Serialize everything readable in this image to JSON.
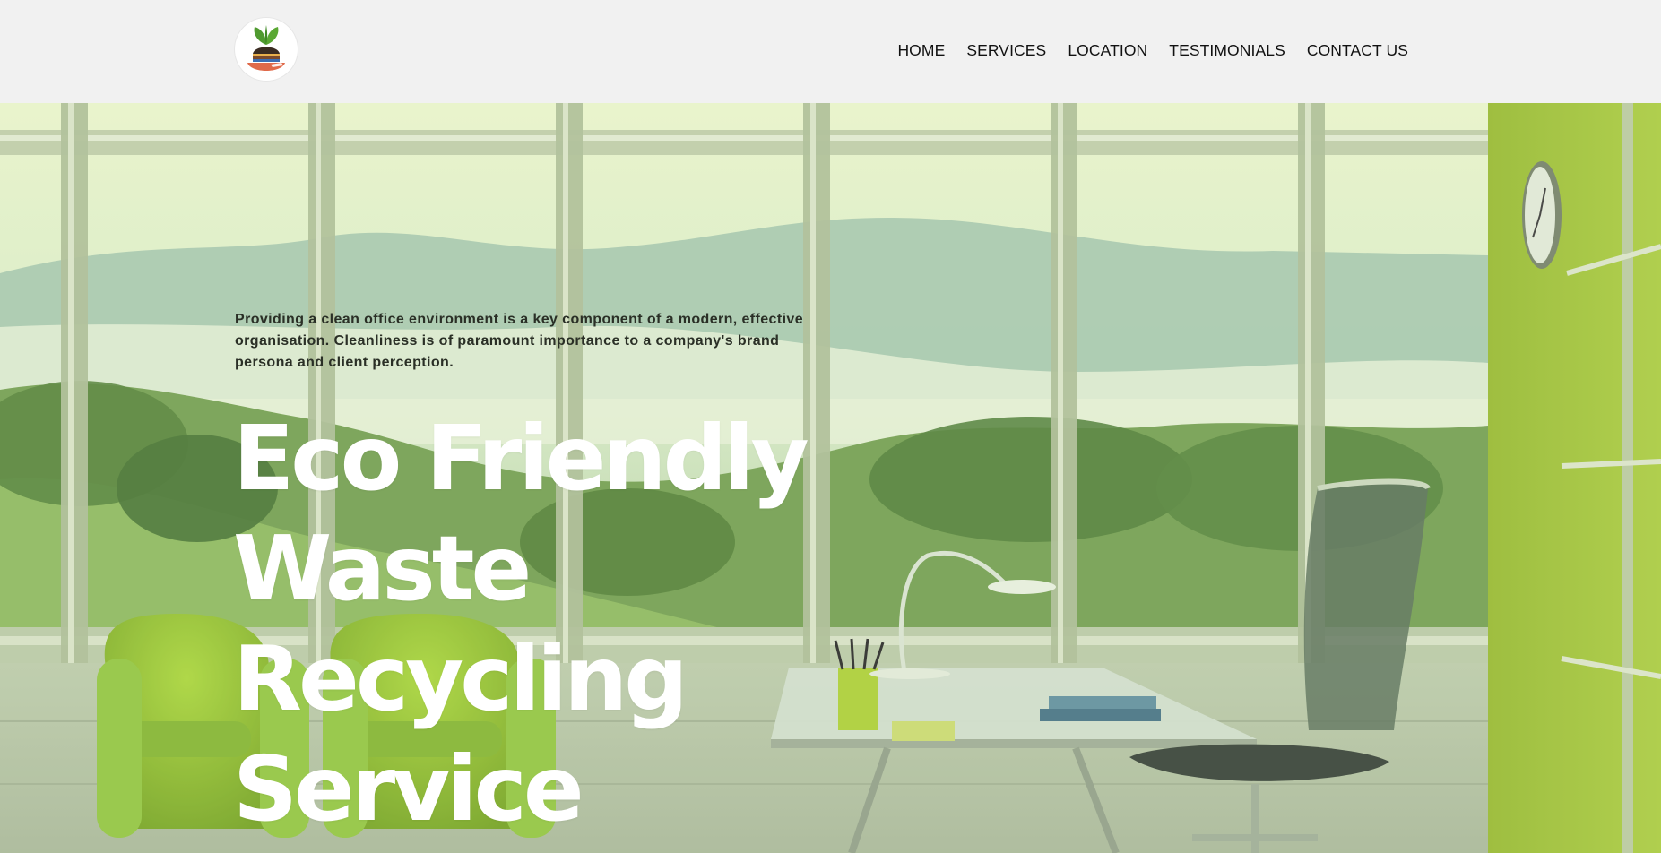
{
  "header": {
    "logo_name": "plant-soil-logo",
    "nav": [
      {
        "label": "HOME"
      },
      {
        "label": "SERVICES"
      },
      {
        "label": "LOCATION"
      },
      {
        "label": "TESTIMONIALS"
      },
      {
        "label": "CONTACT US"
      }
    ]
  },
  "hero": {
    "intro": "Providing a clean office environment is a key component of a modern, effective organisation. Cleanliness is of paramount importance to a company's brand persona and client perception.",
    "headline_lines": [
      "Eco Friendly",
      "Waste",
      "Recycling",
      "Service"
    ]
  },
  "colors": {
    "header_bg": "#f1f1f1",
    "nav_text": "#111111",
    "headline": "#ffffff",
    "accent_green": "#8db32a",
    "wall_green": "#9bbd2c"
  }
}
